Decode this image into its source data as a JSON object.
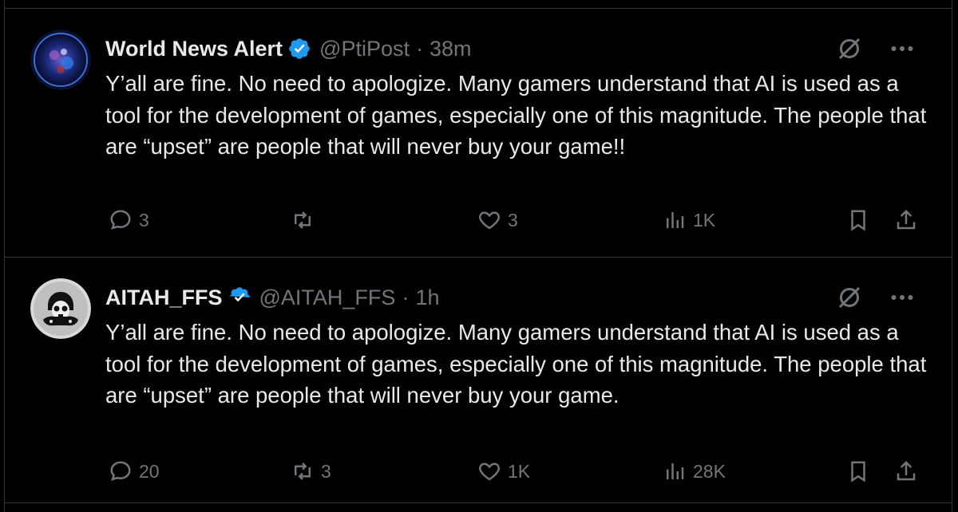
{
  "tweets": [
    {
      "name": "World News Alert",
      "handle": "@PtiPost",
      "separator": "·",
      "time": "38m",
      "text": "Y’all are fine. No need to apologize. Many gamers understand that AI is used as a tool for the development of games, especially one of this magnitude. The people that are “upset” are people that will never buy your game!!",
      "replies": "3",
      "retweets": "",
      "likes": "3",
      "views": "1K",
      "avatar_icon": "blue-globe-avatar-icon"
    },
    {
      "name": "AITAH_FFS",
      "handle": "@AITAH_FFS",
      "separator": "·",
      "time": "1h",
      "text": "Y’all are fine. No need to apologize. Many gamers understand that AI is used as a tool for the development of games, especially one of this magnitude. The people that are “upset” are people that will never buy your game.",
      "replies": "20",
      "retweets": "3",
      "likes": "1K",
      "views": "28K",
      "avatar_icon": "skull-gamer-avatar-icon"
    }
  ],
  "colors": {
    "background": "#000000",
    "text": "#e7e9ea",
    "muted": "#71767b",
    "verified": "#1d9bf0",
    "border": "#2f3336"
  }
}
